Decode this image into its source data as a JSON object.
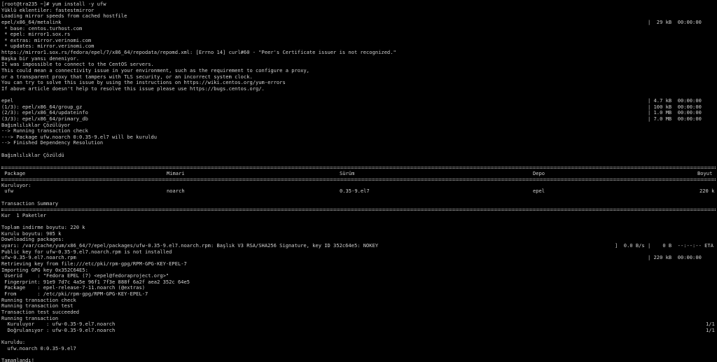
{
  "terminal": {
    "prompt_line": "[root@tra235 ~]# yum install -y ufw",
    "colors": {
      "background": "#000000",
      "foreground": "#d0d0d0"
    }
  },
  "lines": [
    {
      "t": "Yüklü eklentiler: fastestmirror"
    },
    {
      "t": "Loading mirror speeds from cached hostfile"
    },
    {
      "t": "epel/x86_64/metalink",
      "r": "|  29 kB  00:00:00"
    },
    {
      "t": " * base: centos.turhost.com"
    },
    {
      "t": " * epel: mirror1.sox.rs"
    },
    {
      "t": " * extras: mirror.verinomi.com"
    },
    {
      "t": " * updates: mirror.verinomi.com"
    },
    {
      "t": "https://mirror1.sox.rs/fedora/epel/7/x86_64/repodata/repomd.xml: [Errno 14] curl#60 - \"Peer's Certificate issuer is not recognized.\""
    },
    {
      "t": "Başka bir yansı deneniyor."
    },
    {
      "t": "It was impossible to connect to the CentOS servers."
    },
    {
      "t": "This could mean a connectivity issue in your environment, such as the requirement to configure a proxy,"
    },
    {
      "t": "or a transparent proxy that tampers with TLS security, or an incorrect system clock."
    },
    {
      "t": "You can try to solve this issue by using the instructions on https://wiki.centos.org/yum-errors"
    },
    {
      "t": "If above article doesn't help to resolve this issue please use https://bugs.centos.org/."
    },
    {
      "t": ""
    },
    {
      "t": "epel",
      "r": "| 4.7 kB  00:00:00"
    },
    {
      "t": "(1/3): epel/x86_64/group_gz",
      "r": "| 100 kB  00:00:00"
    },
    {
      "t": "(2/3): epel/x86_64/updateinfo",
      "r": "| 1.0 MB  00:00:00"
    },
    {
      "t": "(3/3): epel/x86_64/primary_db",
      "r": "| 7.0 MB  00:00:00"
    },
    {
      "t": "Bağımlılıklar Çözülüyor"
    },
    {
      "t": "--> Running transaction check"
    },
    {
      "t": "---> Package ufw.noarch 0:0.35-9.el7 will be kuruldu"
    },
    {
      "t": "--> Finished Dependency Resolution"
    },
    {
      "t": ""
    },
    {
      "t": "Bağımlılıklar Çözüldü"
    },
    {
      "t": ""
    },
    {
      "kind": "rule2"
    },
    {
      "kind": "cols",
      "cells": [
        {
          "t": " Package",
          "c": 0
        },
        {
          "t": "Mimari",
          "c": 236
        },
        {
          "t": "Sürüm",
          "c": 483
        },
        {
          "t": "Depo",
          "c": 759
        },
        {
          "t": "Boyut",
          "c": 994
        }
      ]
    },
    {
      "kind": "rule2"
    },
    {
      "t": "Kuruluyor:"
    },
    {
      "kind": "cols",
      "cells": [
        {
          "t": " ufw",
          "c": 0
        },
        {
          "t": "noarch",
          "c": 236
        },
        {
          "t": "0.35-9.el7",
          "c": 483
        },
        {
          "t": "epel",
          "c": 759
        },
        {
          "t": "220 k",
          "c": 997
        }
      ]
    },
    {
      "t": ""
    },
    {
      "t": "Transaction Summary"
    },
    {
      "kind": "rule2"
    },
    {
      "t": "Kur  1 Paketler"
    },
    {
      "t": ""
    },
    {
      "t": "Toplam indirme boyutu: 220 k"
    },
    {
      "t": "Kurulu boyutu: 905 k"
    },
    {
      "t": "Downloading packages:"
    },
    {
      "t": "uyarı: /var/cache/yum/x86_64/7/epel/packages/ufw-0.35-9.el7.noarch.rpm: Başlık V3 RSA/SHA256 Signature, key ID 352c64e5: NOKEY",
      "r": "]  0.0 B/s |    0 B  --:--:-- ETA",
      "rc": 876
    },
    {
      "t": "Public key for ufw-0.35-9.el7.noarch.rpm is not installed"
    },
    {
      "t": "ufw-0.35-9.el7.noarch.rpm",
      "r": "| 220 kB  00:00:00"
    },
    {
      "t": "Retrieving key from file:///etc/pki/rpm-gpg/RPM-GPG-KEY-EPEL-7"
    },
    {
      "t": "Importing GPG key 0x352C64E5:"
    },
    {
      "t": " Userid     : \"Fedora EPEL (7) <epel@fedoraproject.org>\""
    },
    {
      "t": " Fingerprint: 91e9 7d7c 4a5e 96f1 7f3e 888f 6a2f aea2 352c 64e5"
    },
    {
      "t": " Package    : epel-release-7-11.noarch (@extras)"
    },
    {
      "t": " From       : /etc/pki/rpm-gpg/RPM-GPG-KEY-EPEL-7"
    },
    {
      "t": "Running transaction check"
    },
    {
      "t": "Running transaction test"
    },
    {
      "t": "Transaction test succeeded"
    },
    {
      "t": "Running transaction"
    },
    {
      "t": "  Kuruluyor    : ufw-0.35-9.el7.noarch",
      "r": "1/1",
      "rc": 1006
    },
    {
      "t": "  Doğrulanıyor : ufw-0.35-9.el7.noarch",
      "r": "1/1",
      "rc": 1006
    },
    {
      "t": ""
    },
    {
      "t": "Kuruldu:"
    },
    {
      "t": "  ufw.noarch 0:0.35-9.el7"
    },
    {
      "t": ""
    },
    {
      "t": "Tamamlandı!"
    }
  ]
}
